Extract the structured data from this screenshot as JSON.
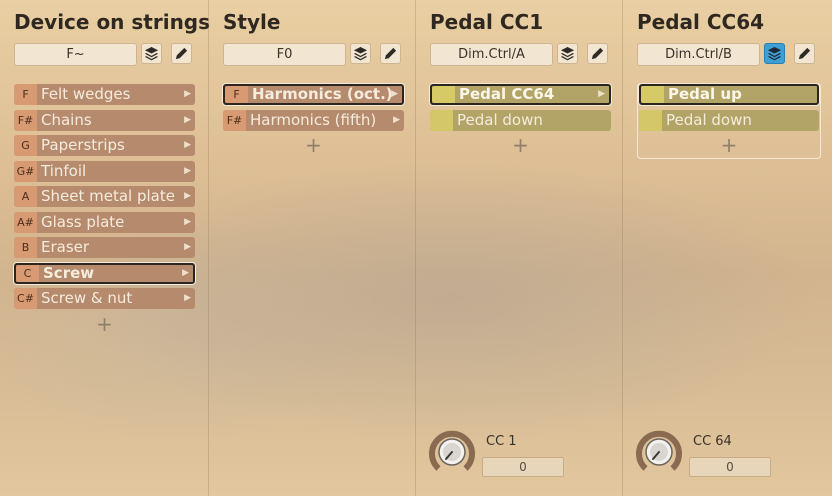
{
  "columns": [
    {
      "title": "Device on strings",
      "selector": "F~",
      "items": [
        {
          "key": "F",
          "label": "Felt wedges"
        },
        {
          "key": "F#",
          "label": "Chains"
        },
        {
          "key": "G",
          "label": "Paperstrips"
        },
        {
          "key": "G#",
          "label": "Tinfoil"
        },
        {
          "key": "A",
          "label": "Sheet metal plate"
        },
        {
          "key": "A#",
          "label": "Glass plate"
        },
        {
          "key": "B",
          "label": "Eraser"
        },
        {
          "key": "C",
          "label": "Screw"
        },
        {
          "key": "C#",
          "label": "Screw & nut"
        }
      ],
      "add": "+"
    },
    {
      "title": "Style",
      "selector": "F0",
      "items": [
        {
          "key": "F",
          "label": "Harmonics (oct.)"
        },
        {
          "key": "F#",
          "label": "Harmonics (fifth)"
        }
      ],
      "add": "+"
    },
    {
      "title": "Pedal CC1",
      "selector": "Dim.Ctrl/A",
      "items": [
        {
          "key": "",
          "label": "Pedal CC64"
        },
        {
          "key": "",
          "label": "Pedal down"
        }
      ],
      "add": "+",
      "cc_label": "CC 1",
      "cc_value": "0"
    },
    {
      "title": "Pedal CC64",
      "selector": "Dim.Ctrl/B",
      "items": [
        {
          "key": "",
          "label": "Pedal up"
        },
        {
          "key": "",
          "label": "Pedal down"
        }
      ],
      "add": "+",
      "cc_label": "CC 64",
      "cc_value": "0"
    }
  ],
  "icons": {
    "layers": "layers-icon",
    "edit": "pencil-icon",
    "arrow": "▶"
  },
  "colors": {
    "accent": "#3d9fd6",
    "brown_item": "#b68a6c",
    "olive_item": "#b2a466"
  }
}
